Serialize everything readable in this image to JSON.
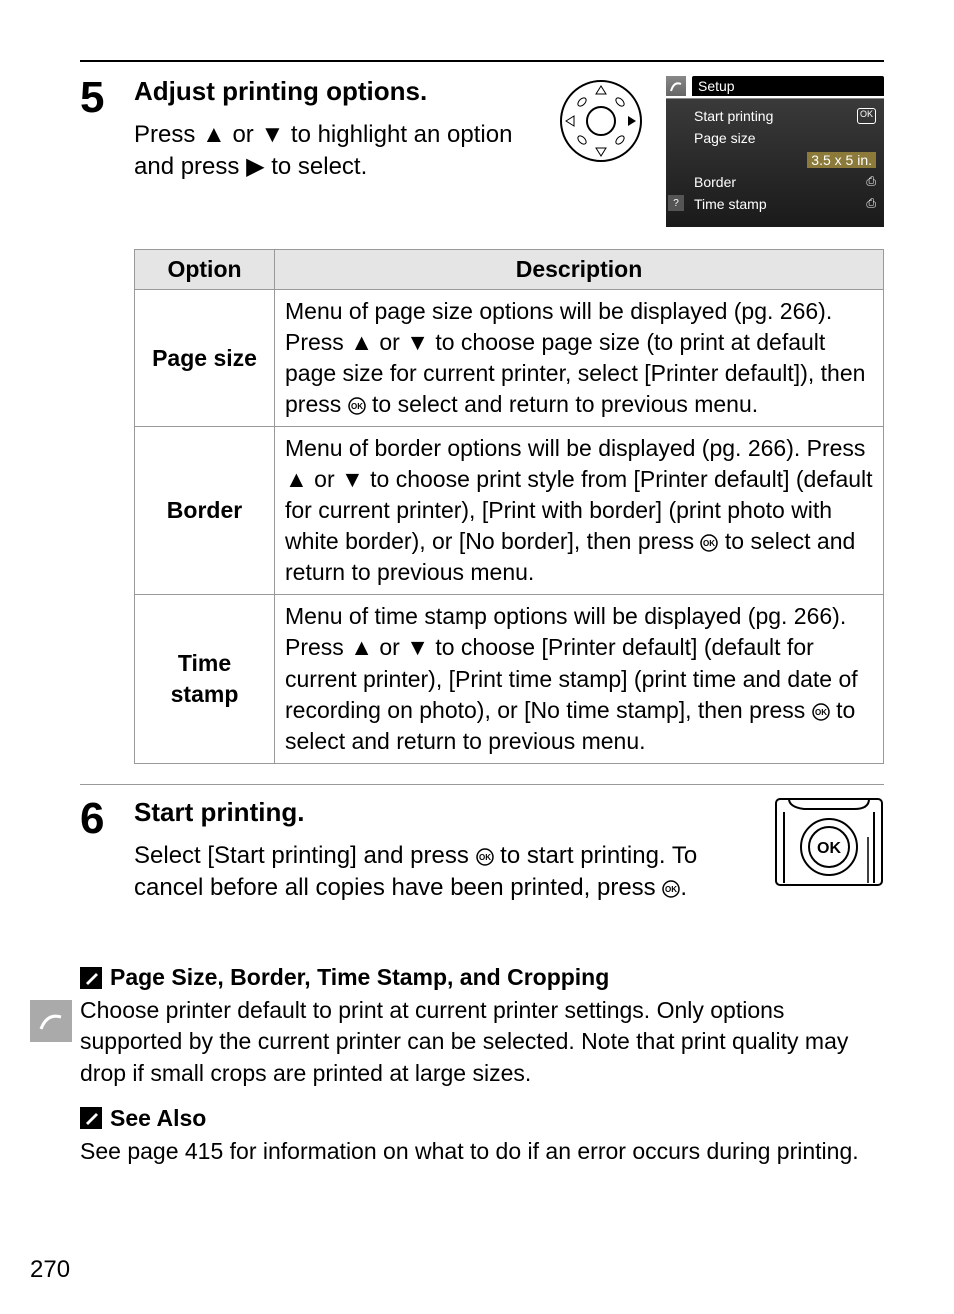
{
  "step5": {
    "number": "5",
    "title": "Adjust printing options.",
    "text_before": "Press ",
    "text_mid": " or ",
    "text_after_arrows": " to highlight an option and press ",
    "text_end": " to select."
  },
  "screen": {
    "title": "Setup",
    "items": {
      "start_printing": "Start printing",
      "page_size": "Page size",
      "page_size_val": "3.5 x 5 in.",
      "border": "Border",
      "time_stamp": "Time stamp"
    }
  },
  "table": {
    "header_option": "Option",
    "header_desc": "Description",
    "page_size": {
      "label": "Page size",
      "desc_a": "Menu of page size options will be displayed (pg. 266). Press ",
      "desc_b": " or ",
      "desc_c": " to choose page size (to print at default page size for current printer, select [Printer default]), then press ",
      "desc_d": " to select and return to previous menu."
    },
    "border": {
      "label": "Border",
      "desc_a": "Menu of border options will be displayed (pg. 266).  Press ",
      "desc_b": " or ",
      "desc_c": " to choose print style from [Printer default] (default for current printer), [Print with border] (print photo with white border), or [No border], then press ",
      "desc_d": " to select and return to previous menu."
    },
    "time_stamp": {
      "label1": "Time",
      "label2": "stamp",
      "desc_a": "Menu of time stamp options will be displayed (pg. 266). Press ",
      "desc_b": " or ",
      "desc_c": " to choose [Printer default] (default for current printer), [Print time stamp] (print time and date of recording on photo), or [No time stamp], then press ",
      "desc_d": " to select and return to previous menu."
    }
  },
  "step6": {
    "number": "6",
    "title": "Start printing.",
    "text_a": "Select  [Start printing] and press ",
    "text_b": " to start printing.  To cancel before all copies have been printed, press ",
    "text_c": "."
  },
  "note1": {
    "heading": "Page Size, Border, Time Stamp, and Cropping",
    "body": "Choose printer default to print at current printer settings.  Only options supported by the current printer can be selected. Note that print quality may drop if small crops are printed at large sizes."
  },
  "note2": {
    "heading": "See Also",
    "body": "See page 415 for information on what to do if an error occurs during printing."
  },
  "page_number": "270",
  "glyph": {
    "up": "▲",
    "down": "▼",
    "right": "▶",
    "ok": "OK"
  }
}
